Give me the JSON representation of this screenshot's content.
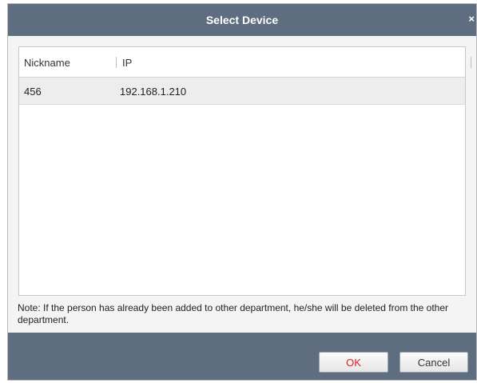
{
  "dialog": {
    "title": "Select Device",
    "close_icon": "×"
  },
  "table": {
    "columns": [
      "Nickname",
      "IP"
    ],
    "rows": [
      {
        "nickname": "456",
        "ip": "192.168.1.210"
      }
    ]
  },
  "note": "Note: If the person has already been added to other department, he/she will be deleted from the other department.",
  "buttons": {
    "ok": "OK",
    "cancel": "Cancel"
  },
  "colors": {
    "titlebar": "#5e6e80",
    "ok_text": "#d6212b"
  }
}
